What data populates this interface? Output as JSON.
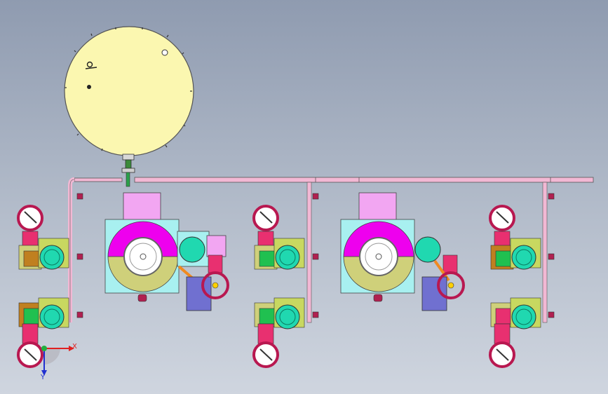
{
  "viewport": {
    "background_top": "#8f9bb0",
    "background_bottom": "#cfd5df"
  },
  "triad": {
    "x_label": "X",
    "y_label": "Y",
    "x_color": "#e02020",
    "y_color": "#2030d0",
    "origin_color": "#20b040"
  },
  "colors": {
    "tank": "#fbf7b0",
    "pipe": "#f2b8d4",
    "magenta": "#ee00ee",
    "pink": "#f2a6f2",
    "olive": "#cfd07a",
    "cyan": "#a8f0f0",
    "teal": "#20d8b0",
    "red_pink": "#e83070",
    "frame_green": "#c8d860",
    "orange": "#f08a20",
    "purple": "#7070d0",
    "ring": "#b81850"
  }
}
